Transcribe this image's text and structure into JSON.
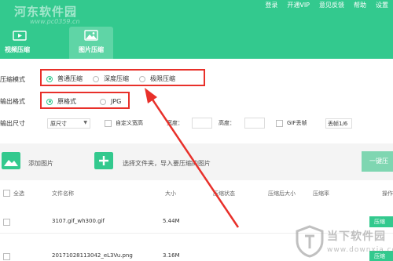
{
  "header": {
    "logo_text": "河东软件园",
    "logo_sub": "www.pc0359.cn",
    "links": [
      "登录",
      "开通VIP",
      "意见反馈",
      "帮助",
      "设置"
    ],
    "tabs": [
      {
        "label": "视频压缩",
        "icon": "video-icon"
      },
      {
        "label": "图片压缩",
        "icon": "image-icon"
      }
    ],
    "accent_color": "#33c98e"
  },
  "compress_mode": {
    "label": "压缩模式",
    "options": [
      "普通压缩",
      "深度压缩",
      "极限压缩"
    ],
    "selected": "普通压缩"
  },
  "output_format": {
    "label": "输出格式",
    "options": [
      "原格式",
      "JPG"
    ],
    "selected": "原格式"
  },
  "output_size": {
    "label": "输出尺寸",
    "size_value": "原尺寸",
    "custom_label": "自定义宽高",
    "width_label": "宽度：",
    "height_label": "高度：",
    "gif_label": "GIF丢帧",
    "frame_value": "丢帧1/6"
  },
  "actions": {
    "add_image": "添加图片",
    "select_folder": "选择文件夹，导入要压缩的图片",
    "one_key": "一键压"
  },
  "table": {
    "columns": [
      "全选",
      "文件名称",
      "大小",
      "压缩状态",
      "压缩后大小",
      "压缩率",
      "操作"
    ],
    "rows": [
      {
        "name": "3107.gif_wh300.gif",
        "size": "5.44M",
        "action": "压缩"
      },
      {
        "name": "20171028113042_eL3Vu.png",
        "size": "3.16M",
        "action": "压缩"
      }
    ]
  },
  "watermark": {
    "main": "当下软件园",
    "sub": "www.downxia.com"
  },
  "annotation_color": "#e8302a"
}
